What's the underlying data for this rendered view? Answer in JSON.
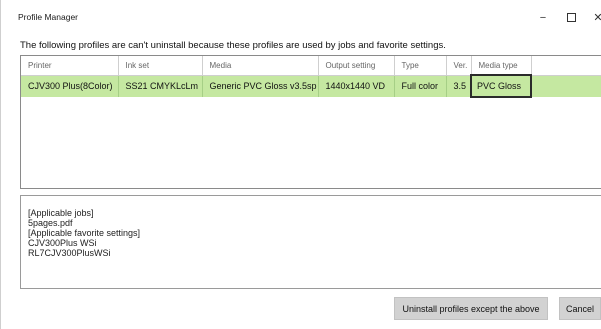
{
  "window": {
    "title": "Profile Manager",
    "minimize_glyph": "−",
    "close_glyph": "✕"
  },
  "message": "The following profiles are can't uninstall because these profiles are used by jobs and favorite settings.",
  "grid": {
    "columns": [
      "Printer",
      "Ink set",
      "Media",
      "Output setting",
      "Type",
      "Ver.",
      "Media type"
    ],
    "rows": [
      {
        "printer": "CJV300 Plus(8Color)",
        "ink_set": "SS21 CMYKLcLm",
        "media": "Generic PVC Gloss v3.5sp",
        "output_setting": "1440x1440 VD",
        "type": "Full color",
        "ver": "3.5",
        "media_type": "PVC Gloss"
      }
    ],
    "row_color": "#c5e8a1"
  },
  "details": {
    "lines": [
      "[Applicable jobs]",
      "5pages.pdf",
      "[Applicable favorite settings]",
      "CJV300Plus WSi",
      "RL7CJV300PlusWSi"
    ]
  },
  "buttons": {
    "uninstall": "Uninstall profiles except the above",
    "cancel": "Cancel"
  }
}
